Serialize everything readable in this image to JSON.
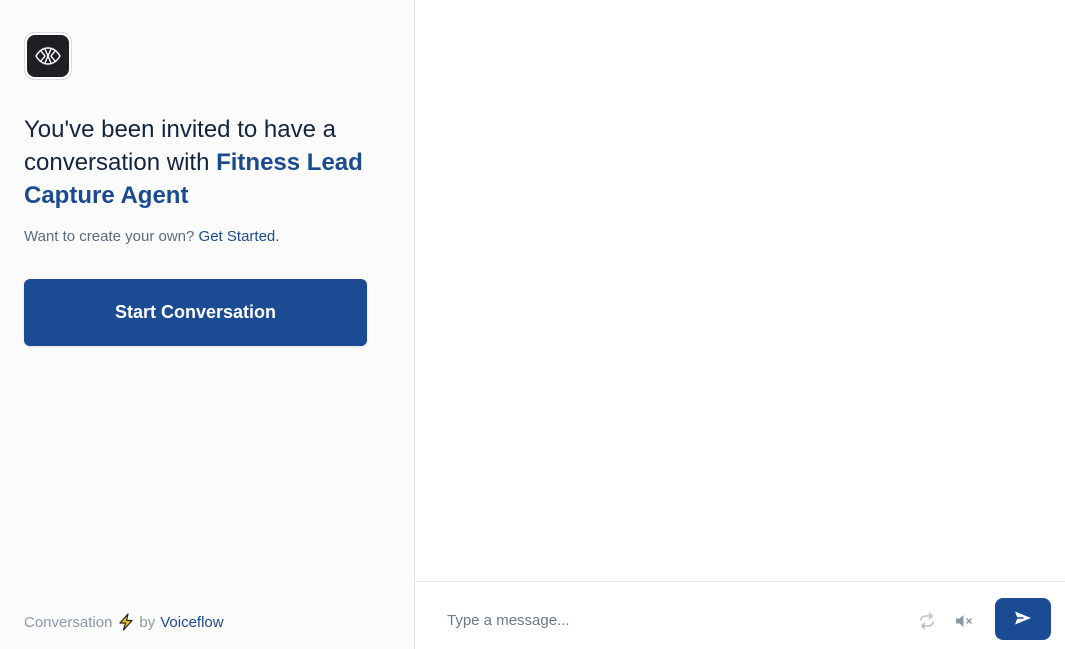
{
  "sidebar": {
    "logo_icon": "voiceflow-logo-icon",
    "headline_prefix": "You've been invited to have a conversation with ",
    "agent_name": "Fitness Lead Capture Agent",
    "create_prompt": "Want to create your own?",
    "get_started_link": "Get Started.",
    "start_button": "Start Conversation",
    "footer": {
      "conversation_text": "Conversation",
      "bolt_icon": "lightning-bolt-icon",
      "by_text": "by",
      "brand_link": "Voiceflow"
    }
  },
  "chat": {
    "input_placeholder": "Type a message...",
    "input_value": "",
    "restart_icon": "restart-icon",
    "mute_icon": "mute-icon",
    "send_icon": "send-icon"
  },
  "colors": {
    "primary": "#1b4b93",
    "heading_text": "#13243f",
    "muted_text": "#8c97a8",
    "bolt_fill": "#f5c518"
  }
}
